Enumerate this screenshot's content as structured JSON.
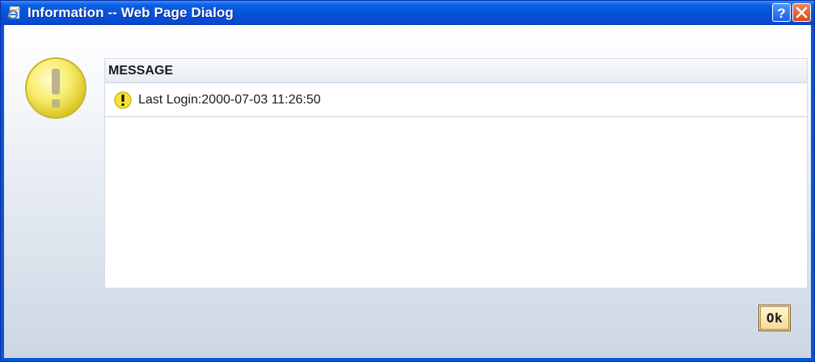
{
  "window": {
    "title": "Information -- Web Page Dialog",
    "title_icon": "ie-page-icon",
    "help_icon": "help-icon",
    "close_icon": "close-icon"
  },
  "dialog": {
    "status_icon": "warning-icon",
    "panel_header": "MESSAGE",
    "messages": [
      {
        "icon": "warning-icon",
        "text": "Last Login:2000-07-03 11:26:50"
      }
    ],
    "ok_label": "Ok"
  },
  "colors": {
    "titlebar": "#0552d8",
    "warning_yellow": "#f5e54a",
    "ok_button": "#f3dc95"
  }
}
